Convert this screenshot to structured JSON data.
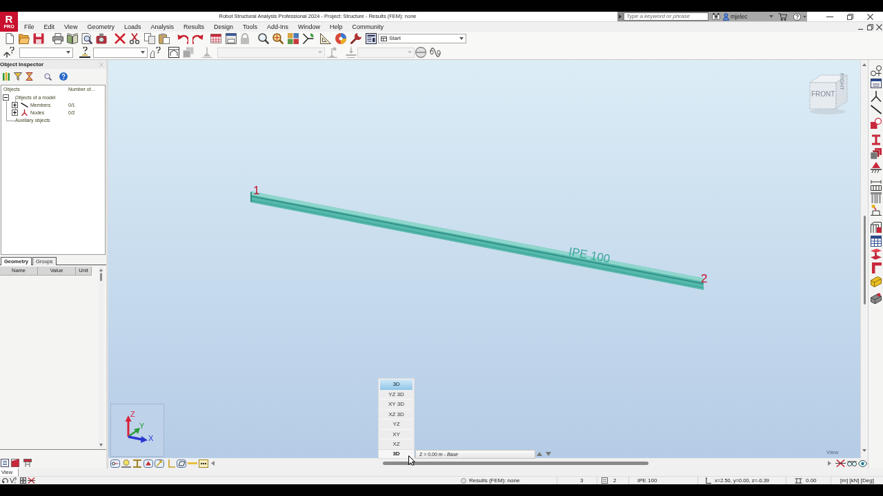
{
  "window": {
    "title": "Robot Structural Analysis Professional 2024 - Project: Structure - Results (FEM): none",
    "logo": {
      "letter": "R",
      "edition": "PRO"
    }
  },
  "help_search": {
    "placeholder": "Type a keyword or phrase"
  },
  "account": {
    "user": "mjelec"
  },
  "menu": [
    "File",
    "Edit",
    "View",
    "Geometry",
    "Loads",
    "Analysis",
    "Results",
    "Design",
    "Tools",
    "Add-Ins",
    "Window",
    "Help",
    "Community"
  ],
  "toolbar": {
    "layout": {
      "value": "Start"
    },
    "dropdowns": [
      {
        "disabled": false
      },
      {
        "disabled": false
      },
      {
        "disabled": true
      },
      {
        "disabled": true
      }
    ]
  },
  "object_inspector": {
    "title": "Object Inspector",
    "columns": [
      "Objects",
      "Number of..."
    ],
    "tree": [
      {
        "label": "Objects of a model",
        "expanded": true,
        "children": [
          {
            "label": "Members",
            "kind": "member",
            "count": "0/1",
            "expanded": false
          },
          {
            "label": "Nodes",
            "kind": "node",
            "count": "0/2",
            "expanded": false
          }
        ]
      },
      {
        "label": "Auxiliary objects"
      }
    ],
    "tabs": [
      {
        "label": "Geometry",
        "selected": true
      },
      {
        "label": "Groups",
        "selected": false
      }
    ],
    "properties_columns": [
      "Name",
      "Value",
      "Unit"
    ]
  },
  "viewport": {
    "nodes": [
      {
        "label": "1"
      },
      {
        "label": "2"
      }
    ],
    "member": {
      "section": "IPE 100"
    },
    "view_cube": {
      "front": "FRONT",
      "right": "RIGHT"
    },
    "axes": {
      "z": "Z",
      "y": "Y",
      "x": "X"
    },
    "view_menu": {
      "items": [
        {
          "label": "3D",
          "selected": true
        },
        {
          "label": "YZ 3D",
          "selected": false
        },
        {
          "label": "XY 3D",
          "selected": false
        },
        {
          "label": "XZ 3D",
          "selected": false
        },
        {
          "label": "YZ",
          "selected": false
        },
        {
          "label": "XY",
          "selected": false
        },
        {
          "label": "XZ",
          "selected": false
        }
      ]
    },
    "view_button": "3D",
    "level": "Z = 0.00 m - *Base*",
    "corner_label": "View"
  },
  "bottom_tab": "View",
  "status_bar": {
    "results": "Results (FEM): none",
    "field_2": "3",
    "field_3": "2",
    "section": "IPE 100",
    "coordinates": "x=2.50, y=0.00, z=-0.39",
    "field_6": "0.00",
    "units": "[m] [kN] [Deg]"
  }
}
